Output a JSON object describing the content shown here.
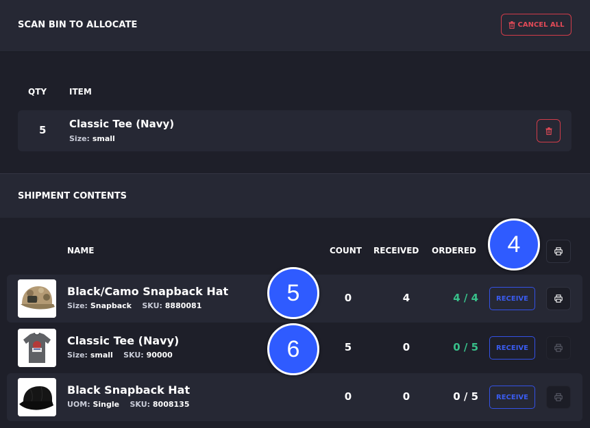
{
  "header": {
    "title": "SCAN BIN TO ALLOCATE",
    "cancel_all_label": "CANCEL ALL"
  },
  "allocation": {
    "columns": {
      "qty": "QTY",
      "item": "ITEM"
    },
    "items": [
      {
        "qty": "5",
        "name": "Classic Tee (Navy)",
        "size_key": "Size:",
        "size_value": "small"
      }
    ]
  },
  "shipment": {
    "title": "SHIPMENT CONTENTS",
    "columns": {
      "name": "NAME",
      "count": "COUNT",
      "received": "RECEIVED",
      "ordered": "ORDERED"
    },
    "items": [
      {
        "name": "Black/Camo Snapback Hat",
        "meta1_key": "Size:",
        "meta1_value": "Snapback",
        "sku_key": "SKU:",
        "sku_value": "8880081",
        "count": "0",
        "received": "4",
        "ordered": "4 / 4",
        "receive_label": "RECEIVE"
      },
      {
        "name": "Classic Tee (Navy)",
        "meta1_key": "Size:",
        "meta1_value": "small",
        "sku_key": "SKU:",
        "sku_value": "90000",
        "count": "5",
        "received": "0",
        "ordered": "0 / 5",
        "receive_label": "RECEIVE"
      },
      {
        "name": "Black Snapback Hat",
        "meta1_key": "UOM:",
        "meta1_value": "Single",
        "sku_key": "SKU:",
        "sku_value": "8008135",
        "count": "0",
        "received": "0",
        "ordered": "0 / 5",
        "receive_label": "RECEIVE"
      }
    ]
  },
  "badges": [
    "4",
    "5",
    "6"
  ],
  "colors": {
    "background": "#1e1f29",
    "panel": "#262834",
    "danger": "#d23c4a",
    "accent": "#3452e8",
    "success": "#38c08a",
    "badge": "#2f5bff"
  },
  "icons": {
    "trash": "trash-icon",
    "printer": "printer-icon"
  }
}
